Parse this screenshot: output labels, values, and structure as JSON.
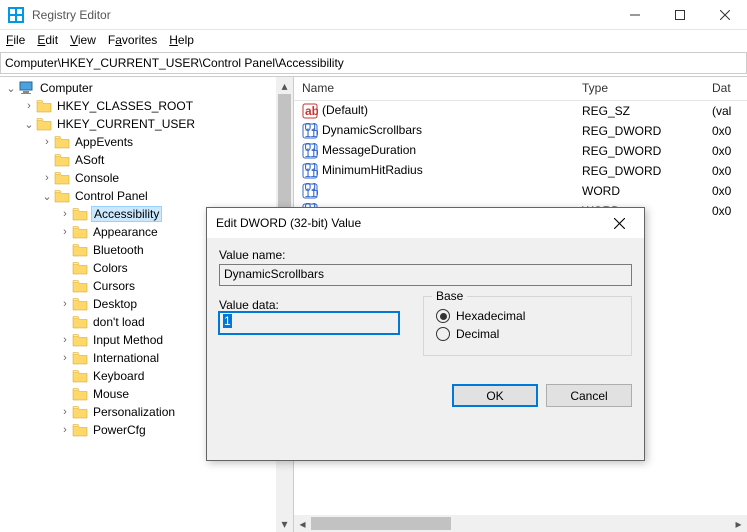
{
  "titlebar": {
    "app_name": "Registry Editor"
  },
  "menubar": {
    "file": "File",
    "edit": "Edit",
    "view": "View",
    "favorites": "Favorites",
    "help": "Help"
  },
  "addressbar": {
    "path": "Computer\\HKEY_CURRENT_USER\\Control Panel\\Accessibility"
  },
  "tree": {
    "root": "Computer",
    "items": [
      {
        "label": "HKEY_CLASSES_ROOT",
        "indent": 1,
        "chev": ">"
      },
      {
        "label": "HKEY_CURRENT_USER",
        "indent": 1,
        "chev": "v"
      },
      {
        "label": "AppEvents",
        "indent": 2,
        "chev": ">"
      },
      {
        "label": "ASoft",
        "indent": 2,
        "chev": ""
      },
      {
        "label": "Console",
        "indent": 2,
        "chev": ">"
      },
      {
        "label": "Control Panel",
        "indent": 2,
        "chev": "v"
      },
      {
        "label": "Accessibility",
        "indent": 3,
        "chev": ">",
        "selected": true
      },
      {
        "label": "Appearance",
        "indent": 3,
        "chev": ">"
      },
      {
        "label": "Bluetooth",
        "indent": 3,
        "chev": ""
      },
      {
        "label": "Colors",
        "indent": 3,
        "chev": ""
      },
      {
        "label": "Cursors",
        "indent": 3,
        "chev": ""
      },
      {
        "label": "Desktop",
        "indent": 3,
        "chev": ">"
      },
      {
        "label": "don't load",
        "indent": 3,
        "chev": ""
      },
      {
        "label": "Input Method",
        "indent": 3,
        "chev": ">"
      },
      {
        "label": "International",
        "indent": 3,
        "chev": ">"
      },
      {
        "label": "Keyboard",
        "indent": 3,
        "chev": ""
      },
      {
        "label": "Mouse",
        "indent": 3,
        "chev": ""
      },
      {
        "label": "Personalization",
        "indent": 3,
        "chev": ">"
      },
      {
        "label": "PowerCfg",
        "indent": 3,
        "chev": ">"
      }
    ]
  },
  "list": {
    "headers": {
      "name": "Name",
      "type": "Type",
      "data": "Dat"
    },
    "rows": [
      {
        "icon": "str",
        "name": "(Default)",
        "type": "REG_SZ",
        "data": "(val"
      },
      {
        "icon": "bin",
        "name": "DynamicScrollbars",
        "type": "REG_DWORD",
        "data": "0x0"
      },
      {
        "icon": "bin",
        "name": "MessageDuration",
        "type": "REG_DWORD",
        "data": "0x0"
      },
      {
        "icon": "bin",
        "name": "MinimumHitRadius",
        "type": "REG_DWORD",
        "data": "0x0"
      },
      {
        "icon": "bin",
        "name": "",
        "type": "WORD",
        "data": "0x0"
      },
      {
        "icon": "bin",
        "name": "",
        "type": "WORD",
        "data": "0x0"
      }
    ]
  },
  "dialog": {
    "title": "Edit DWORD (32-bit) Value",
    "value_name_label": "Value name:",
    "value_name": "DynamicScrollbars",
    "value_data_label": "Value data:",
    "value_data": "1",
    "base_label": "Base",
    "hex_label": "Hexadecimal",
    "dec_label": "Decimal",
    "ok": "OK",
    "cancel": "Cancel"
  }
}
